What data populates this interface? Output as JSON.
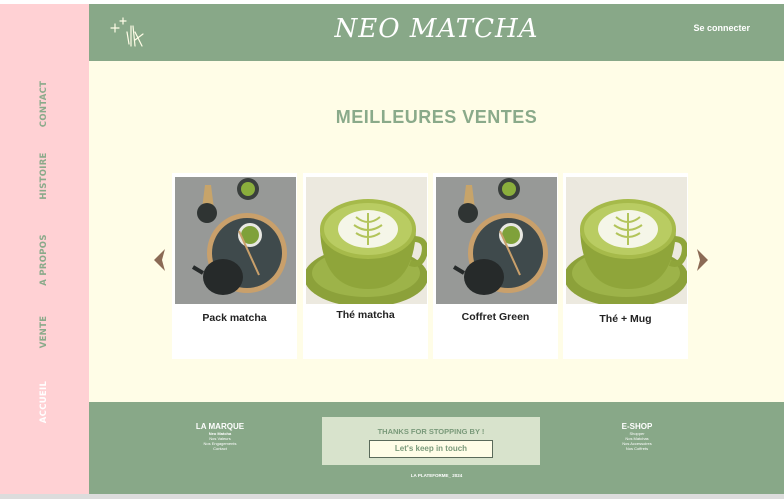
{
  "sidebar": {
    "items": [
      {
        "label": "CONTACT"
      },
      {
        "label": "HISTOIRE"
      },
      {
        "label": "A PROPOS"
      },
      {
        "label": "VENTE"
      },
      {
        "label": "ACCUEIL"
      }
    ]
  },
  "header": {
    "brand": "NEO MATCHA",
    "login": "Se connecter"
  },
  "main": {
    "title": "MEILLEURES VENTES",
    "products": [
      {
        "name": "Pack matcha",
        "image": "matcha-set-photo"
      },
      {
        "name": "Thé matcha",
        "image": "matcha-latte-photo"
      },
      {
        "name": "Coffret Green",
        "image": "matcha-set-photo"
      },
      {
        "name": "Thé + Mug",
        "image": "matcha-latte-photo"
      }
    ],
    "prev_icon": "chevron-left-icon",
    "next_icon": "chevron-right-icon"
  },
  "footer": {
    "brand_col": {
      "title": "LA MARQUE",
      "links": [
        "Neo Matcha",
        "Nos Valeurs",
        "Nos Engagements",
        "Contact"
      ]
    },
    "contact": {
      "title": "THANKS FOR STOPPING BY !",
      "button": "Let's keep in touch"
    },
    "shop_col": {
      "title": "E-SHOP",
      "links": [
        "Shopper",
        "Nos Matchas",
        "Nos Accessoires",
        "Nos Coffrets"
      ]
    },
    "copyright": "LA PLATEFORME_ 2024"
  },
  "colors": {
    "sage": "#88a888",
    "pink": "#ffd1d4",
    "cream": "#fffde7",
    "arrow": "#8b6a55"
  }
}
